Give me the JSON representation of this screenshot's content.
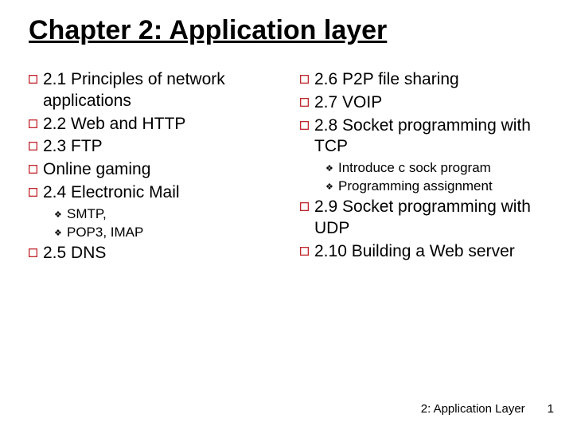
{
  "title": "Chapter 2: Application layer",
  "left": [
    {
      "text": "2.1 Principles of network applications",
      "subs": []
    },
    {
      "text": "2.2 Web and HTTP",
      "subs": []
    },
    {
      "text": "2.3 FTP",
      "subs": []
    },
    {
      "text": "Online gaming",
      "subs": []
    },
    {
      "text": "2.4 Electronic Mail",
      "subs": [
        "SMTP,",
        "POP3, IMAP"
      ]
    },
    {
      "text": "2.5 DNS",
      "subs": []
    }
  ],
  "right": [
    {
      "text": "2.6 P2P file sharing",
      "subs": []
    },
    {
      "text": "2.7 VOIP",
      "subs": []
    },
    {
      "text": "2.8 Socket programming with TCP",
      "subs": [
        "Introduce c sock program",
        "Programming assignment"
      ]
    },
    {
      "text": "2.9 Socket programming with UDP",
      "subs": []
    },
    {
      "text": "2.10 Building a Web server",
      "subs": []
    }
  ],
  "footer": {
    "label": "2: Application Layer",
    "page": "1"
  }
}
